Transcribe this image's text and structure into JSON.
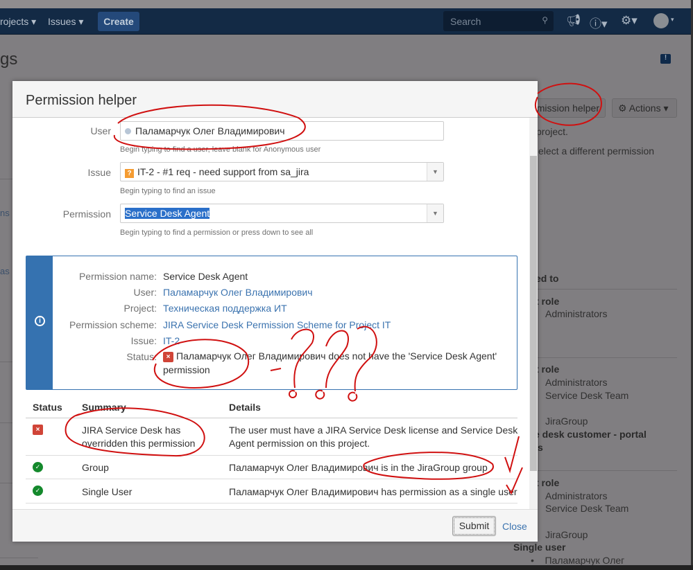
{
  "navbar": {
    "projects": "rojects",
    "issues": "Issues",
    "create": "Create",
    "search_placeholder": "Search"
  },
  "page": {
    "title_fragment": "gs",
    "left_items": [
      "ns",
      "as"
    ],
    "header_buttons": {
      "permission_helper": "mission helper",
      "actions": "Actions"
    },
    "intro_lines": [
      "project.",
      "elect a different permission"
    ],
    "granted_to_header": "ed to",
    "groups": [
      {
        "heading": "t role",
        "items": [
          "Administrators"
        ]
      },
      {
        "heading": "t role",
        "items": [
          "Administrators",
          "Service Desk Team"
        ],
        "sub": "JiraGroup",
        "extra": "e desk customer - portal",
        "extra2": "s"
      },
      {
        "heading": "t role",
        "items": [
          "Administrators",
          "Service Desk Team"
        ],
        "sub": "JiraGroup",
        "single_user_heading": "Single user",
        "single_user": "Паламарчук Олег"
      }
    ]
  },
  "modal": {
    "title": "Permission helper",
    "form": {
      "user_label": "User",
      "user_value": "Паламарчук Олег Владимирович",
      "user_hint": "Begin typing to find a user, leave blank for Anonymous user",
      "issue_label": "Issue",
      "issue_value": "IT-2 - #1 req - need support from sa_jira",
      "issue_hint": "Begin typing to find an issue",
      "permission_label": "Permission",
      "permission_value": "Service Desk Agent",
      "permission_hint": "Begin typing to find a permission or press down to see all"
    },
    "info": {
      "labels": [
        "Permission name:",
        "User:",
        "Project:",
        "Permission scheme:",
        "Issue:",
        "Status:"
      ],
      "permission_name": "Service Desk Agent",
      "user": "Паламарчук Олег Владимирович",
      "project": "Техническая поддержка ИТ",
      "scheme": "JIRA Service Desk Permission Scheme for Project IT",
      "issue": "IT-2",
      "status_line1": "Паламарчук Олег Владимирович does not have the 'Service Desk Agent'",
      "status_line2": "permission"
    },
    "table": {
      "headers": [
        "Status",
        "Summary",
        "Details"
      ],
      "rows": [
        {
          "status": "fail",
          "summary1": "JIRA Service Desk has",
          "summary2": "overridden this permission",
          "details1": "The user must have a JIRA Service Desk license and Service Desk",
          "details2": "Agent permission on this project."
        },
        {
          "status": "ok",
          "summary": "Group",
          "details": "Паламарчук Олег Владимирович is in the JiraGroup group"
        },
        {
          "status": "ok",
          "summary": "Single User",
          "details": "Паламарчук Олег Владимирович has permission as a single user"
        }
      ]
    },
    "footer": {
      "submit": "Submit",
      "close": "Close"
    }
  },
  "colors": {
    "navbar": "#132a45",
    "accent": "#3572b0",
    "error": "#d04437",
    "success": "#14892c",
    "annotation": "#d01010"
  }
}
